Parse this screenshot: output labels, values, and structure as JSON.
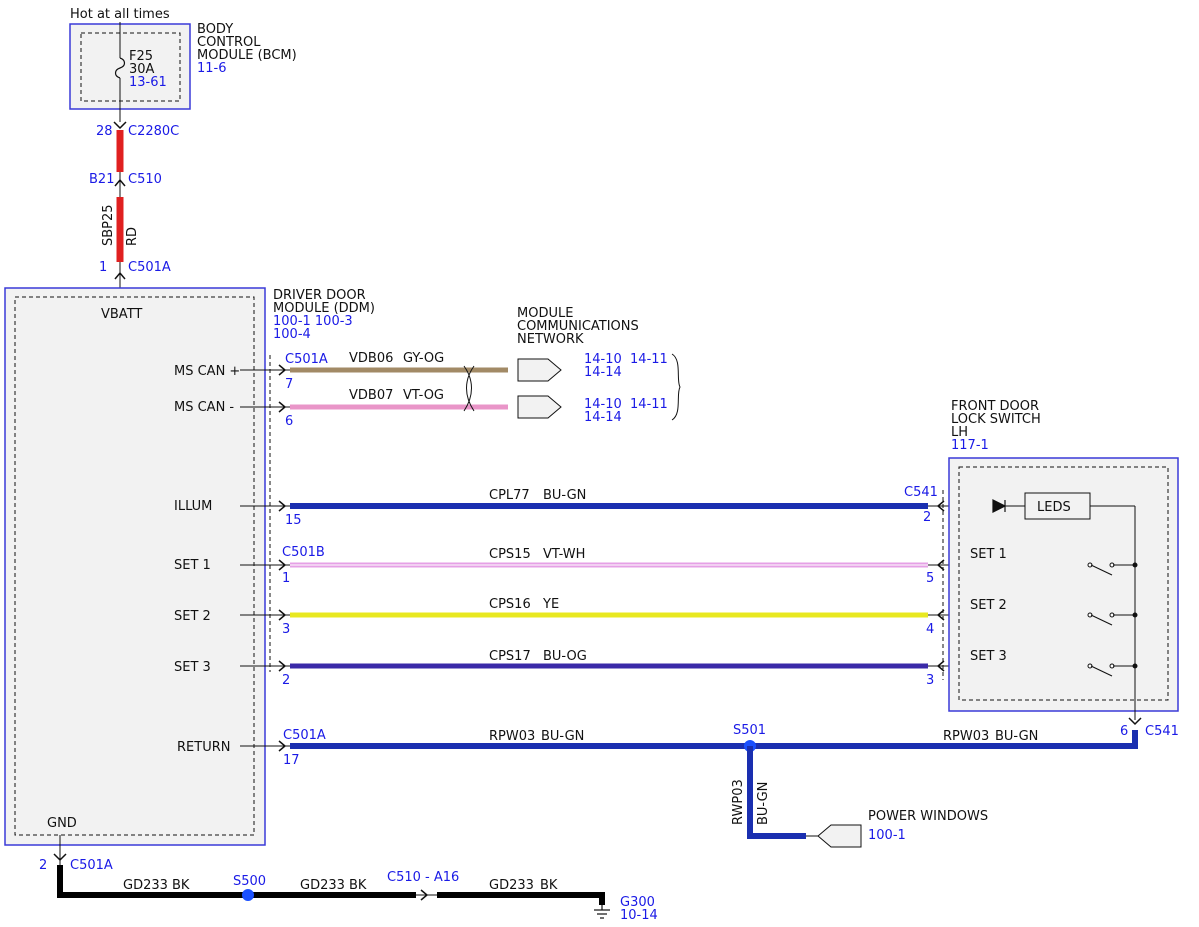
{
  "colors": {
    "ref_text": "#1a1ae6",
    "module_border": "#3a3ad8",
    "module_fill": "#f2f2f2",
    "wire_red": "#e02020",
    "wire_gy_og": "#a28a66",
    "wire_vt_og": "#e995c8",
    "wire_bu_gn": "#1a2fb0",
    "wire_vt_wh": "#e6a0e6",
    "wire_ye": "#e8e820",
    "wire_bu_og": "#3a2aa8",
    "wire_bk": "#000000",
    "splice": "#1a50ff"
  },
  "top": {
    "hot_label": "Hot at all times",
    "fuse": {
      "name": "F25",
      "rating": "30A",
      "ref": "13-61"
    },
    "bcm": {
      "line1": "BODY",
      "line2": "CONTROL",
      "line3": "MODULE (BCM)",
      "ref": "11-6"
    },
    "c2280c": {
      "pin": "28",
      "name": "C2280C"
    },
    "c510": {
      "pin": "B21",
      "name": "C510"
    },
    "wire": {
      "circuit": "SBP25",
      "color": "RD"
    },
    "c501a_top": {
      "pin": "1",
      "name": "C501A"
    }
  },
  "ddm": {
    "vbatt": "VBATT",
    "gnd": "GND",
    "title1": "DRIVER DOOR",
    "title2": "MODULE (DDM)",
    "ref1": "100-1 100-3",
    "ref2": "100-4",
    "pins": {
      "ms_can_plus": "MS CAN +",
      "ms_can_minus": "MS CAN -",
      "illum": "ILLUM",
      "set1": "SET 1",
      "set2": "SET 2",
      "set3": "SET 3",
      "return": "RETURN"
    }
  },
  "network": {
    "line1": "MODULE",
    "line2": "COMMUNICATIONS",
    "line3": "NETWORK",
    "can_plus_ref1": "14-10  14-11",
    "can_plus_ref2": "14-14",
    "can_minus_ref1": "14-10  14-11",
    "can_minus_ref2": "14-14"
  },
  "wires": {
    "vdb06": {
      "connector": "C501A",
      "pin": "7",
      "circuit": "VDB06",
      "color": "GY-OG"
    },
    "vdb07": {
      "pin": "6",
      "circuit": "VDB07",
      "color": "VT-OG"
    },
    "cpl77": {
      "pin_left": "15",
      "circuit": "CPL77",
      "color": "BU-GN",
      "connector_right": "C541",
      "pin_right": "2"
    },
    "cps15": {
      "connector": "C501B",
      "pin_left": "1",
      "circuit": "CPS15",
      "color": "VT-WH",
      "pin_right": "5"
    },
    "cps16": {
      "pin_left": "3",
      "circuit": "CPS16",
      "color": "YE",
      "pin_right": "4"
    },
    "cps17": {
      "pin_left": "2",
      "circuit": "CPS17",
      "color": "BU-OG",
      "pin_right": "3"
    },
    "rpw03_left": {
      "connector": "C501A",
      "pin": "17",
      "circuit": "RPW03",
      "color": "BU-GN"
    },
    "rpw03_right": {
      "circuit": "RPW03",
      "color": "BU-GN",
      "pin": "6",
      "connector": "C541"
    },
    "rpw03_down": {
      "circuit": "RWP03",
      "color": "BU-GN"
    },
    "s501": "S501"
  },
  "switch": {
    "title1": "FRONT DOOR",
    "title2": "LOCK SWITCH",
    "title3": "LH",
    "ref": "117-1",
    "leds": "LEDS",
    "set1": "SET 1",
    "set2": "SET 2",
    "set3": "SET 3"
  },
  "power_windows": {
    "label": "POWER WINDOWS",
    "ref": "100-1"
  },
  "ground": {
    "pin": "2",
    "connector": "C501A",
    "seg1": {
      "circuit": "GD233",
      "color": "BK"
    },
    "s500": "S500",
    "seg2": {
      "circuit": "GD233",
      "color": "BK"
    },
    "c510": "C510 - A16",
    "seg3": {
      "circuit": "GD233",
      "color": "BK"
    },
    "g300": "G300",
    "g300_ref": "10-14"
  }
}
